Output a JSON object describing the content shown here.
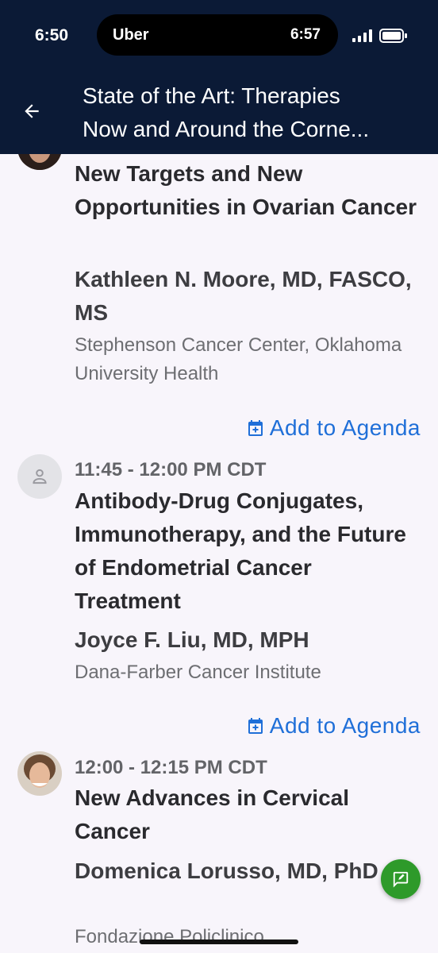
{
  "status_bar": {
    "time": "6:50",
    "live_activity_app": "Uber",
    "live_activity_time": "6:57"
  },
  "header": {
    "title": "State of the Art: Therapies Now and Around the Corne..."
  },
  "sessions": [
    {
      "title": "New Targets and New Opportunities in Ovarian Cancer",
      "speaker": "Kathleen N. Moore,  MD,  FASCO,  MS",
      "affiliation": "Stephenson Cancer Center, Oklahoma University Health",
      "add_label": "Add to Agenda"
    },
    {
      "time": "11:45 - 12:00 PM CDT",
      "title": "Antibody-Drug Conjugates, Immunotherapy, and the Future of Endometrial Cancer Treatment",
      "speaker": "Joyce F. Liu,  MD,  MPH",
      "affiliation": "Dana-Farber Cancer Institute",
      "add_label": "Add to Agenda"
    },
    {
      "time": "12:00 - 12:15 PM CDT",
      "title": "New Advances in Cervical Cancer",
      "speaker": "Domenica Lorusso,  MD,  PhD",
      "affiliation": "Fondazione Policlinico"
    }
  ],
  "colors": {
    "header_bg": "#0b1a36",
    "accent": "#1f6fd8",
    "fab": "#2e9a2a",
    "background": "#f8f5fb"
  },
  "icons": [
    "back-arrow-icon",
    "calendar-add-icon",
    "person-icon",
    "chat-feedback-icon"
  ]
}
